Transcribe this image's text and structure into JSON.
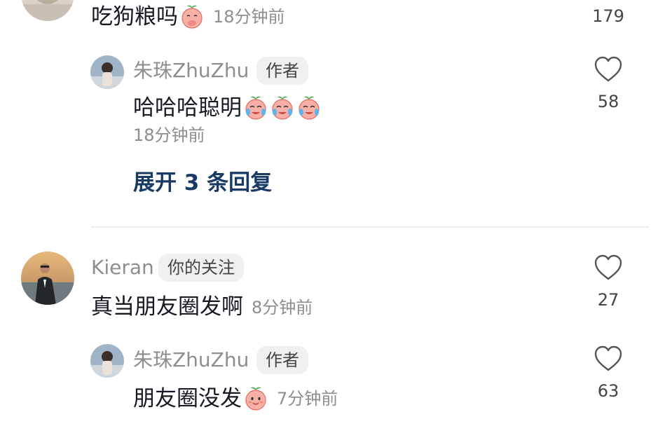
{
  "comments": [
    {
      "text": "吃狗粮吗",
      "time": "18分钟前",
      "likes": "179",
      "emoji": "peach-hand-over-mouth-emoji"
    },
    {
      "user": "朱珠ZhuZhu",
      "badge": "作者",
      "text": "哈哈哈聪明",
      "time": "18分钟前",
      "likes": "58",
      "emoji": "peach-crying-laughing-emoji"
    },
    {
      "user": "Kieran",
      "badge": "你的关注",
      "text": "真当朋友圈发啊",
      "time": "8分钟前",
      "likes": "27"
    },
    {
      "user": "朱珠ZhuZhu",
      "badge": "作者",
      "text": "朋友圈没发",
      "time": "7分钟前",
      "likes": "63",
      "emoji": "peach-smile-emoji"
    }
  ],
  "expand_replies": "展开 3 条回复",
  "colors": {
    "text": "#161823",
    "muted": "#8d8d92",
    "link": "#1a3a66",
    "badge_bg": "#f0f0f3",
    "peach": "#f7a9a0"
  },
  "icons": {
    "like": "heart-outline-icon"
  }
}
